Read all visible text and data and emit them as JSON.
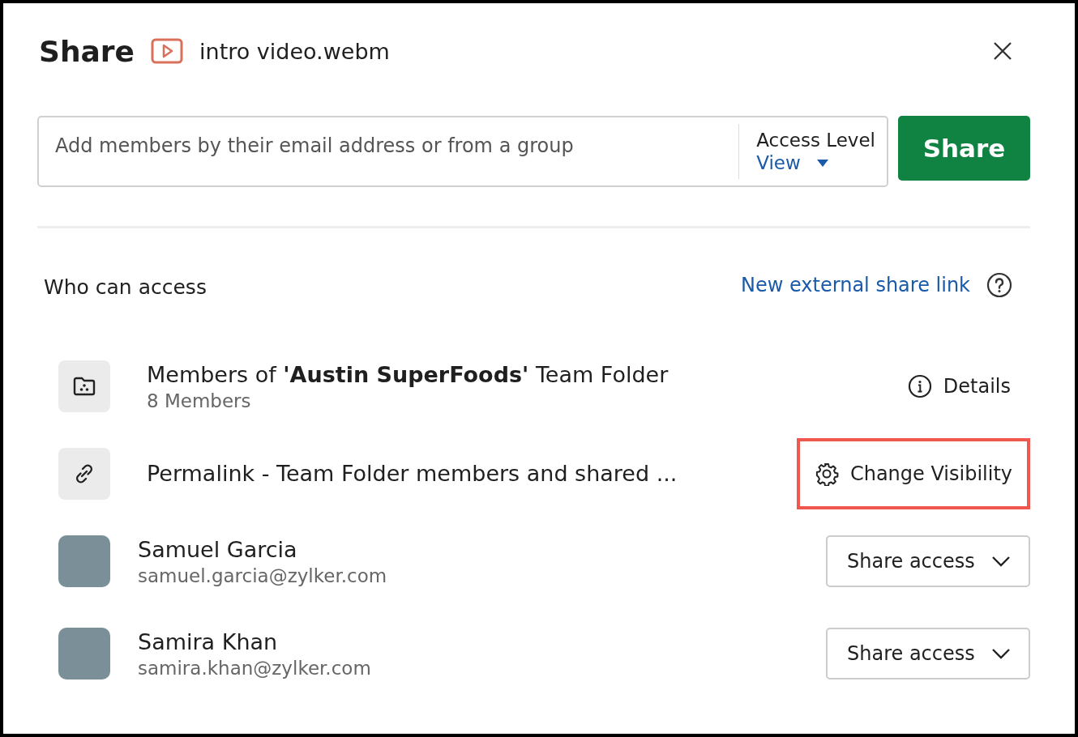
{
  "dialog": {
    "title": "Share",
    "file_name": "intro video.webm"
  },
  "add_members": {
    "placeholder": "Add members by their email address or from a group",
    "access_label": "Access Level",
    "access_value": "View",
    "share_button": "Share"
  },
  "access": {
    "heading": "Who can access",
    "link": "New external share link"
  },
  "entries": [
    {
      "kind": "group",
      "title": "Members of **'Austin SuperFoods'** Team Folder",
      "subtitle": "8 Members",
      "action": {
        "kind": "details",
        "label": "Details",
        "highlighted": false
      }
    },
    {
      "kind": "link",
      "title": "Permalink - Team Folder members and shared ...",
      "action": {
        "kind": "visibility",
        "label": "Change Visibility",
        "highlighted": true
      }
    },
    {
      "kind": "user",
      "title": "Samuel Garcia",
      "subtitle": "samuel.garcia@zylker.com",
      "action": {
        "kind": "dropdown",
        "label": "Share access",
        "highlighted": false
      }
    },
    {
      "kind": "user",
      "title": "Samira Khan",
      "subtitle": "samira.khan@zylker.com",
      "action": {
        "kind": "dropdown",
        "label": "Share access",
        "highlighted": false
      }
    }
  ]
}
